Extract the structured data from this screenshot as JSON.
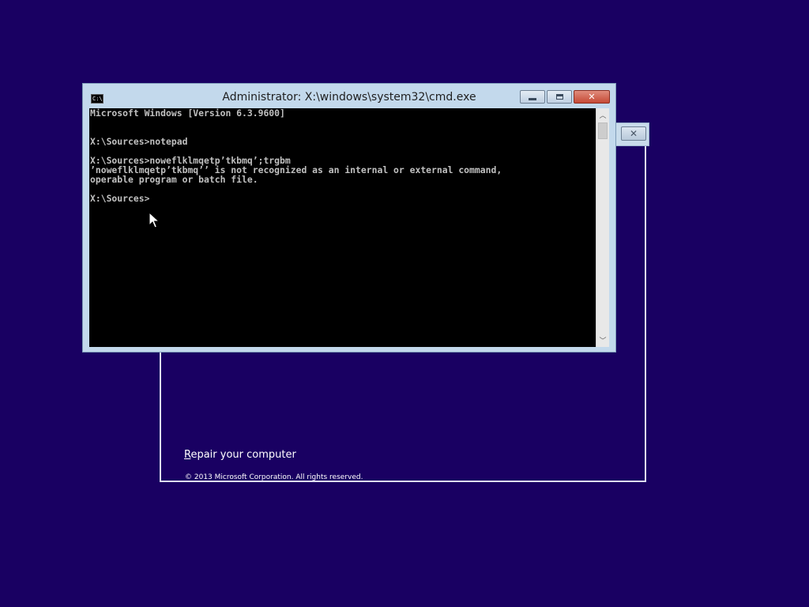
{
  "desktop": {
    "background_color": "#190062"
  },
  "setup_window": {
    "close_glyph": "✕",
    "repair_link": {
      "mnemonic": "R",
      "rest": "epair your computer"
    },
    "copyright": "© 2013 Microsoft Corporation. All rights reserved."
  },
  "cmd_window": {
    "icon_label": "C:\\",
    "title": "Administrator: X:\\windows\\system32\\cmd.exe",
    "buttons": {
      "minimize": "minimize-icon",
      "maximize": "maximize-icon",
      "close": "✕"
    },
    "console_lines": [
      "Microsoft Windows [Version 6.3.9600]",
      "",
      "",
      "X:\\Sources>notepad",
      "",
      "X:\\Sources>noweflklmqetp’tkbmq’;trgbm",
      "’noweflklmqetp’tkbmq’’ is not recognized as an internal or external command,",
      "operable program or batch file.",
      "",
      "X:\\Sources>"
    ],
    "scrollbar": {
      "up_arrow": "︿",
      "down_arrow": "﹀"
    }
  }
}
